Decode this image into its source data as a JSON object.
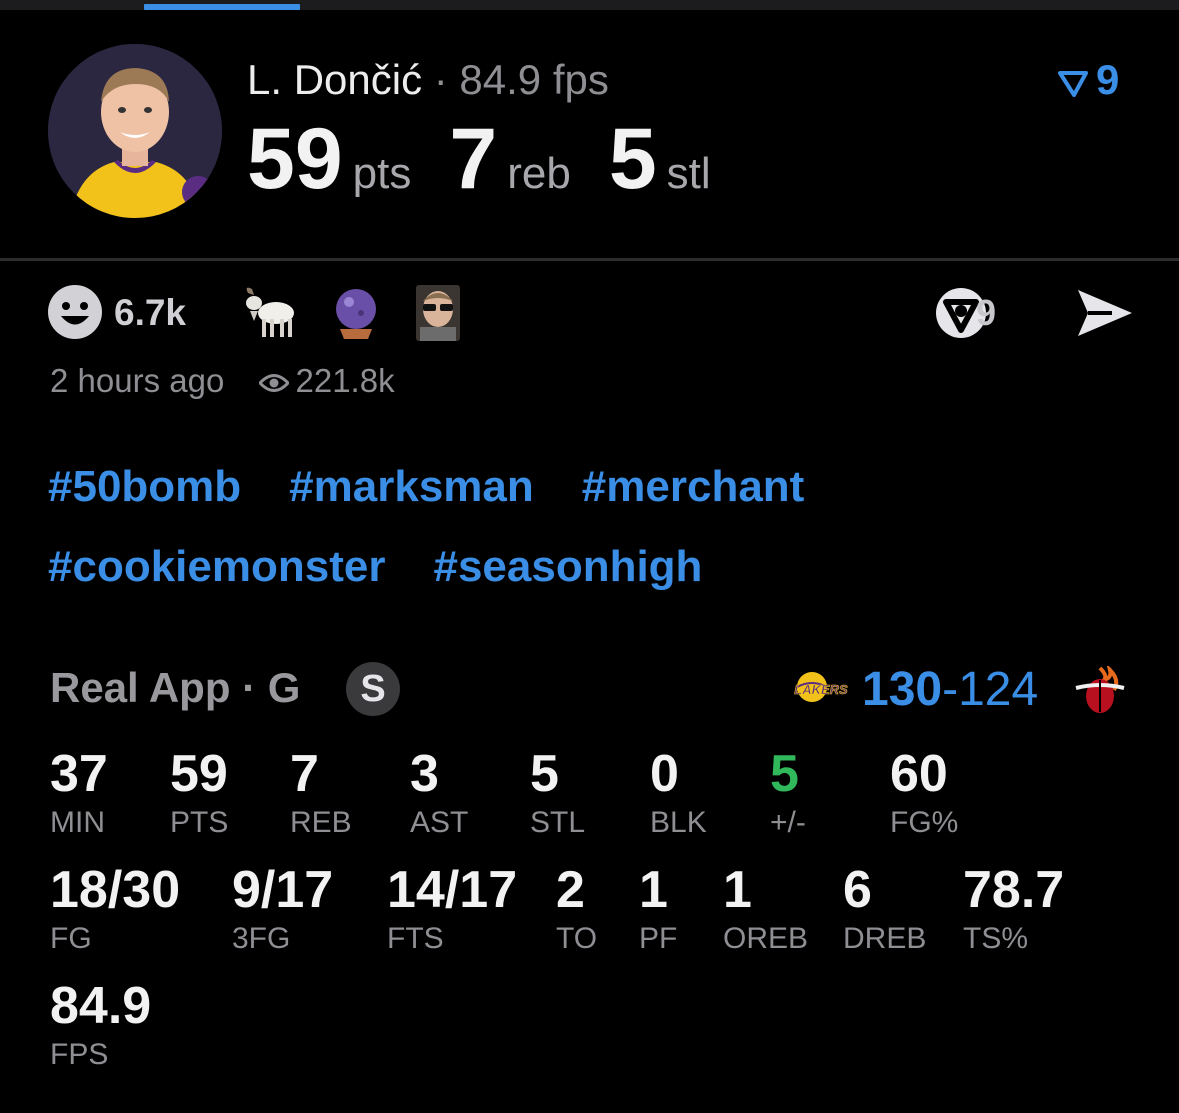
{
  "player": {
    "name": "L. Dončić",
    "separator": "·",
    "fps_label": "84.9 fps",
    "headline": [
      {
        "value": "59",
        "unit": "pts"
      },
      {
        "value": "7",
        "unit": "reb"
      },
      {
        "value": "5",
        "unit": "stl"
      }
    ],
    "jersey_logo_text": "LAKERS"
  },
  "filter_badge": {
    "count": "9",
    "icon": "filter-v-icon"
  },
  "reactions": {
    "smile_count": "6.7k",
    "emojis": [
      "goat-icon",
      "crystal-ball-icon",
      "sunglasses-player-icon"
    ],
    "v_count": "9",
    "share_icon": "send-icon"
  },
  "meta": {
    "time": "2 hours ago",
    "views": "221.8k"
  },
  "hashtags": [
    "#50bomb",
    "#marksman",
    "#merchant",
    "#cookiemonster",
    "#seasonhigh"
  ],
  "game": {
    "label": "Real App · G",
    "badge": "S",
    "home_score": "130",
    "dash": "-",
    "away_score": "124",
    "team_logo_text": "LAKERS"
  },
  "stats": {
    "row1": [
      {
        "value": "37",
        "label": "MIN"
      },
      {
        "value": "59",
        "label": "PTS"
      },
      {
        "value": "7",
        "label": "REB"
      },
      {
        "value": "3",
        "label": "AST"
      },
      {
        "value": "5",
        "label": "STL"
      },
      {
        "value": "0",
        "label": "BLK"
      },
      {
        "value": "5",
        "label": "+/-"
      },
      {
        "value": "60",
        "label": "FG%"
      }
    ],
    "row2": [
      {
        "value": "18/30",
        "label": "FG"
      },
      {
        "value": "9/17",
        "label": "3FG"
      },
      {
        "value": "14/17",
        "label": "FTS"
      },
      {
        "value": "2",
        "label": "TO"
      },
      {
        "value": "1",
        "label": "PF"
      },
      {
        "value": "1",
        "label": "OREB"
      },
      {
        "value": "6",
        "label": "DREB"
      },
      {
        "value": "78.7",
        "label": "TS%"
      }
    ],
    "row3": [
      {
        "value": "84.9",
        "label": "FPS"
      }
    ]
  },
  "colors": {
    "accent": "#3a8ee6",
    "positive": "#30b85a",
    "muted": "#8e8e93",
    "background": "#000000"
  }
}
